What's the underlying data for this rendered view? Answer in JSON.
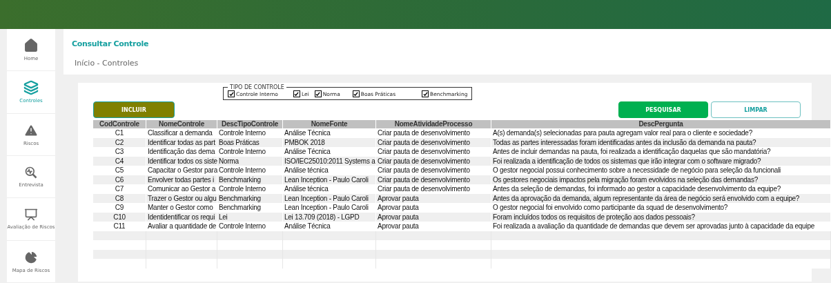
{
  "sidebar": {
    "items": [
      {
        "label": "Home",
        "selected": false
      },
      {
        "label": "Controles",
        "selected": true
      },
      {
        "label": "Riscos",
        "selected": false
      },
      {
        "label": "Entrevista",
        "selected": false
      },
      {
        "label": "Avaliação de Riscos",
        "selected": false
      },
      {
        "label": "Mapa de Riscos",
        "selected": false
      }
    ]
  },
  "header": {
    "title": "Consultar Controle",
    "breadcrumb": "Início - Controles"
  },
  "filter": {
    "legend": "TIPO DE CONTROLE",
    "options": [
      {
        "label": "Controle Interno",
        "checked": true
      },
      {
        "label": "Lei",
        "checked": true
      },
      {
        "label": "Norma",
        "checked": true
      },
      {
        "label": "Boas Práticas",
        "checked": true
      },
      {
        "label": "Benchmarking",
        "checked": true
      }
    ]
  },
  "buttons": {
    "add": "INCLUIR",
    "search": "PESQUISAR",
    "clear": "LIMPAR"
  },
  "table": {
    "columns": [
      "CodControle",
      "NomeControle",
      "DescTipoControle",
      "NomeFonte",
      "NomeAtividadeProcesso",
      "DescPergunta"
    ],
    "rows": [
      [
        "C1",
        "Classificar a demanda",
        "Controle Interno",
        "Análise Técnica",
        "Criar pauta de desenvolvimento",
        "A(s) demanda(s) selecionadas para pauta agregam valor real para o cliente e sociedade?"
      ],
      [
        "C2",
        "Identificar todas as part",
        "Boas Práticas",
        "PMBOK 2018",
        "Criar pauta de desenvolvimento",
        "Todas as partes interessadas foram identificadas antes da inclusão da demanda na pauta?"
      ],
      [
        "C3",
        "Identificação das dema",
        "Controle Interno",
        "Análise Técnica",
        "Criar pauta de desenvolvimento",
        "Antes de incluir demandas na pauta, foi realizada a identificação daquelas que são mandatória?"
      ],
      [
        "C4",
        "Identificar todos os siste",
        "Norma",
        "ISO/IEC25010:2011 Systems a",
        "Criar pauta de desenvolvimento",
        "Foi realizada a identificação de todos os sistemas que irão integrar com o software migrado?"
      ],
      [
        "C5",
        "Capacitar o Gestor para",
        "Controle Interno",
        "Análise técnica",
        "Criar pauta de desenvolvimento",
        "O gestor negocial possui conhecimento sobre a necessidade de negócio para seleção da funcionali"
      ],
      [
        "C6",
        "Envolver todas partes i",
        "Benchmarking",
        "Lean Inception - Paulo Caroli",
        "Criar pauta de desenvolvimento",
        "Os gestores negociais impactos pela migração foram evolvidos na seleção das demandas?"
      ],
      [
        "C7",
        "Comunicar ao Gestor a",
        "Controle Interno",
        "Análise técnica",
        "Criar pauta de desenvolvimento",
        "Antes da seleção de demandas, foi informado ao gestor a capacidade desenvolvimento da equipe?"
      ],
      [
        "C8",
        "Trazer o Gestor ou algu",
        "Benchmarking",
        "Lean Inception - Paulo Caroli",
        "Aprovar pauta",
        "Antes da aprovação da demanda, algum representante da área de negócio será envolvido com a equipe?"
      ],
      [
        "C9",
        "Manter o Gestor como",
        "Benchmarking",
        "Lean Inception - Paulo Caroli",
        "Aprovar pauta",
        "O gestor negocial foi envolvido como participante da squad de desenvolvimento?"
      ],
      [
        "C10",
        "Identidentificar os requi",
        "Lei",
        "Lei 13.709 (2018) - LGPD",
        "Aprovar pauta",
        "Foram incluídos todos os requisitos de proteção aos dados pessoais?"
      ],
      [
        "C11",
        "Avaliar a quantidade de",
        "Controle Interno",
        "Análise Técnica",
        "Aprovar pauta",
        "Foi realizada a avaliação da quantidade de demandas que devem ser aprovadas junto à capacidade da equipe"
      ]
    ]
  }
}
